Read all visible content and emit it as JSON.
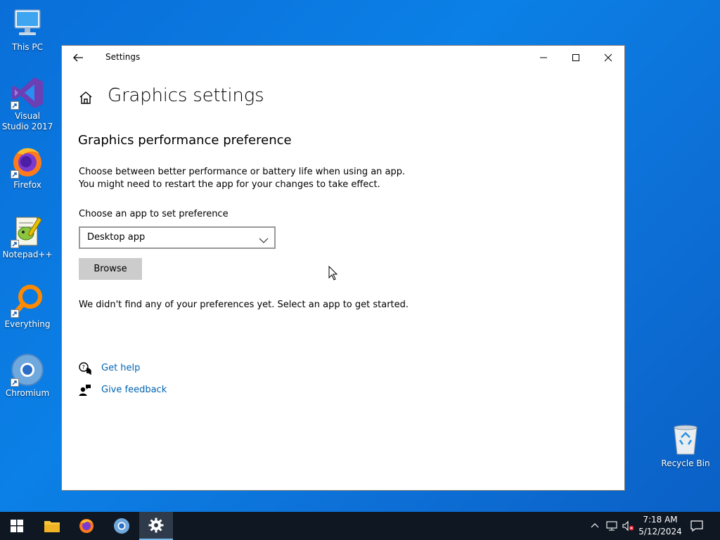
{
  "desktop": {
    "icons": [
      {
        "label": "This PC"
      },
      {
        "label": "Visual Studio 2017"
      },
      {
        "label": "Firefox"
      },
      {
        "label": "Notepad++"
      },
      {
        "label": "Everything"
      },
      {
        "label": "Chromium"
      },
      {
        "label": "Recycle Bin"
      }
    ]
  },
  "window": {
    "title": "Settings",
    "page_title": "Graphics settings",
    "section_title": "Graphics performance preference",
    "description_line1": "Choose between better performance or battery life when using an app.",
    "description_line2": "You might need to restart the app for your changes to take effect.",
    "choose_label": "Choose an app to set preference",
    "dropdown_value": "Desktop app",
    "browse_label": "Browse",
    "empty_message": "We didn't find any of your preferences yet. Select an app to get started.",
    "get_help": "Get help",
    "give_feedback": "Give feedback"
  },
  "taskbar": {
    "time": "7:18 AM",
    "date": "5/12/2024"
  },
  "colors": {
    "link": "#0063b1",
    "desktop_bg": "#0b78e0",
    "taskbar_bg": "#0f1722"
  }
}
